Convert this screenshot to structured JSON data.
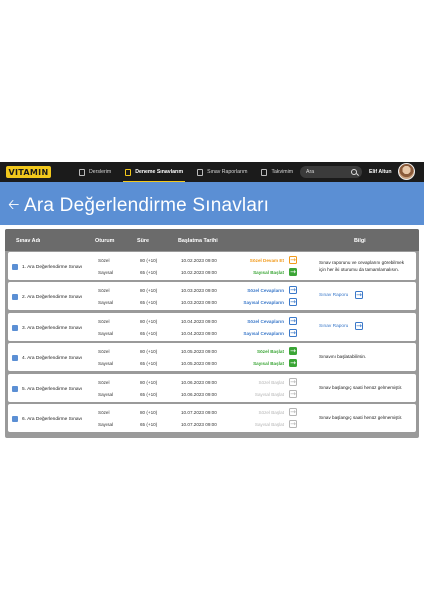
{
  "logo": "VITAMIN",
  "nav": [
    {
      "label": "Derslerim",
      "active": false,
      "icon": "monitor-icon"
    },
    {
      "label": "Deneme Sınavlarım",
      "active": true,
      "icon": "document-icon"
    },
    {
      "label": "Sınav Raporlarım",
      "active": false,
      "icon": "report-icon"
    },
    {
      "label": "Takvimim",
      "active": false,
      "icon": "calendar-icon"
    }
  ],
  "search": {
    "placeholder": "Ara"
  },
  "user": {
    "name": "Elif Altun"
  },
  "page": {
    "title": "Ara Değerlendirme Sınavları",
    "back_icon": "back-arrow-icon"
  },
  "table": {
    "headers": {
      "name": "Sınav Adı",
      "session": "Oturum",
      "duration": "Süre",
      "start": "Başlatma Tarihi",
      "info": "Bilgi"
    }
  },
  "colors": {
    "orange": "#f29a1b",
    "green": "#3aa535",
    "blue": "#3a78c9",
    "grey": "#b5b5b5"
  },
  "exams": [
    {
      "name": "1. Ara Değerlendirme Sınavı",
      "sessions": [
        {
          "label": "Sözel",
          "duration": "80 (+10)",
          "date": "10.02.2023 09:00",
          "status": "Sözel Devam Et",
          "tone": "orange"
        },
        {
          "label": "Sayısal",
          "duration": "65 (+10)",
          "date": "10.02.2023 09:00",
          "status": "Sayısal Başlat",
          "tone": "green"
        }
      ],
      "info": [
        "Sınav raporunu ve cevaplarını görebilmek",
        "için her iki oturumu da tamamlamalısın."
      ],
      "link": ""
    },
    {
      "name": "2. Ara Değerlendirme Sınavı",
      "sessions": [
        {
          "label": "Sözel",
          "duration": "80 (+10)",
          "date": "10.03.2023 09:00",
          "status": "Sözel Cevapların",
          "tone": "blue"
        },
        {
          "label": "Sayısal",
          "duration": "65 (+10)",
          "date": "10.03.2023 09:00",
          "status": "Sayısal Cevapların",
          "tone": "blue"
        }
      ],
      "info": [],
      "link": "Sınav Raporu"
    },
    {
      "name": "3. Ara Değerlendirme Sınavı",
      "sessions": [
        {
          "label": "Sözel",
          "duration": "80 (+10)",
          "date": "10.04.2023 09:00",
          "status": "Sözel Cevapların",
          "tone": "blue"
        },
        {
          "label": "Sayısal",
          "duration": "65 (+10)",
          "date": "10.04.2023 09:00",
          "status": "Sayısal Cevapların",
          "tone": "blue"
        }
      ],
      "info": [],
      "link": "Sınav Raporu"
    },
    {
      "name": "4. Ara Değerlendirme Sınavı",
      "sessions": [
        {
          "label": "Sözel",
          "duration": "80 (+10)",
          "date": "10.05.2023 09:00",
          "status": "Sözel Başlat",
          "tone": "green"
        },
        {
          "label": "Sayısal",
          "duration": "65 (+10)",
          "date": "10.05.2023 09:00",
          "status": "Sayısal Başlat",
          "tone": "green"
        }
      ],
      "info": [
        "Sınavını başlatabilirsin."
      ],
      "link": ""
    },
    {
      "name": "5. Ara Değerlendirme Sınavı",
      "sessions": [
        {
          "label": "Sözel",
          "duration": "80 (+10)",
          "date": "10.06.2023 09:00",
          "status": "Sözel Başlat",
          "tone": "grey"
        },
        {
          "label": "Sayısal",
          "duration": "65 (+10)",
          "date": "10.06.2023 09:00",
          "status": "Sayısal Başlat",
          "tone": "grey"
        }
      ],
      "info": [
        "Sınav başlangıç saati henüz gelmemiştir."
      ],
      "link": ""
    },
    {
      "name": "6. Ara Değerlendirme Sınavı",
      "sessions": [
        {
          "label": "Sözel",
          "duration": "80 (+10)",
          "date": "10.07.2023 09:00",
          "status": "Sözel Başlat",
          "tone": "grey"
        },
        {
          "label": "Sayısal",
          "duration": "65 (+10)",
          "date": "10.07.2023 09:00",
          "status": "Sayısal Başlat",
          "tone": "grey"
        }
      ],
      "info": [
        "Sınav başlangıç saati henüz gelmemiştir."
      ],
      "link": ""
    }
  ]
}
